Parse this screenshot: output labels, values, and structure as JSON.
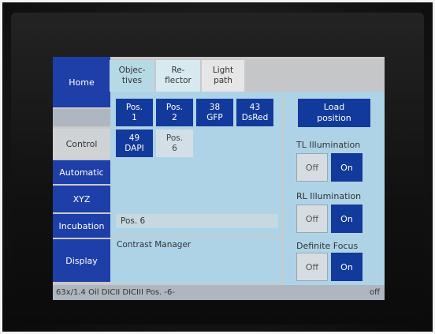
{
  "nav": {
    "home": "Home",
    "control": "Control",
    "automatic": "Automatic",
    "xyz": "XYZ",
    "incubation": "Incubation",
    "display": "Display"
  },
  "tabs": {
    "objectives": [
      "Objec-",
      "tives"
    ],
    "reflector": [
      "Re-",
      "flector"
    ],
    "light_path": [
      "Light",
      "path"
    ]
  },
  "positions": [
    {
      "line1": "Pos.",
      "line2": "1"
    },
    {
      "line1": "Pos.",
      "line2": "2"
    },
    {
      "line1": "38",
      "line2": "GFP"
    },
    {
      "line1": "43",
      "line2": "DsRed"
    },
    {
      "line1": "49",
      "line2": "DAPI"
    },
    {
      "line1": "Pos.",
      "line2": "6"
    }
  ],
  "current_position": "Pos. 6",
  "contrast_manager": "Contrast Manager",
  "right": {
    "load_position": [
      "Load",
      "position"
    ],
    "tl_illumination": "TL Illumination",
    "rl_illumination": "RL Illumination",
    "definite_focus": "Definite Focus",
    "off": "Off",
    "on": "On"
  },
  "status": {
    "left": "63x/1.4 Oil DICII DICIII   Pos. -6-",
    "right": "off"
  },
  "colors": {
    "button_blue": "#123a9c",
    "panel_blue": "#aed3e6",
    "nav_blue": "#1e3fa8"
  }
}
